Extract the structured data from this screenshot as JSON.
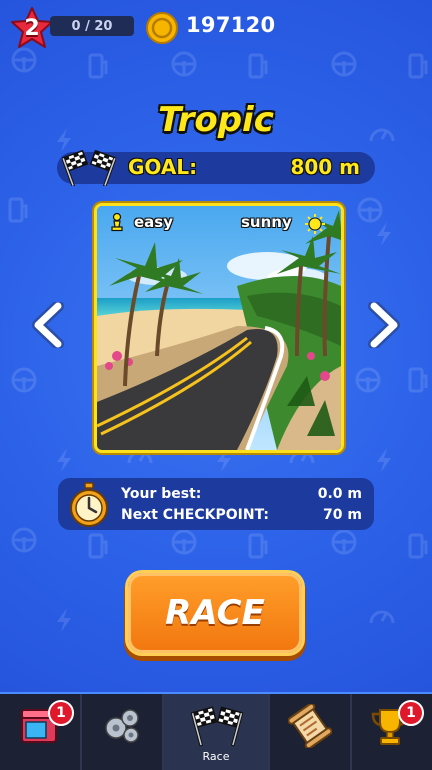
{
  "top_bar": {
    "level": "2",
    "progress": "0 / 20",
    "coins": "197120"
  },
  "track": {
    "name": "Tropic",
    "goal_label": "GOAL:",
    "goal_value": "800 m",
    "difficulty": "easy",
    "weather": "sunny"
  },
  "stats": {
    "best_label": "Your best:",
    "best_value": "0.0 m",
    "checkpoint_label": "Next CHECKPOINT:",
    "checkpoint_value": "70 m"
  },
  "race_button": "RACE",
  "nav": {
    "items": [
      {
        "icon": "shop-icon",
        "badge": "1",
        "label": ""
      },
      {
        "icon": "gears-icon",
        "badge": "",
        "label": ""
      },
      {
        "icon": "checkered-flags-icon",
        "badge": "",
        "label": "Race"
      },
      {
        "icon": "scroll-map-icon",
        "badge": "",
        "label": ""
      },
      {
        "icon": "trophy-icon",
        "badge": "1",
        "label": ""
      }
    ]
  },
  "colors": {
    "background": "#2a5fe6",
    "title_yellow": "#ffe81a",
    "race_orange": "#f2780f",
    "nav_bg": "#1c2233",
    "badge_red": "#e0182c"
  }
}
